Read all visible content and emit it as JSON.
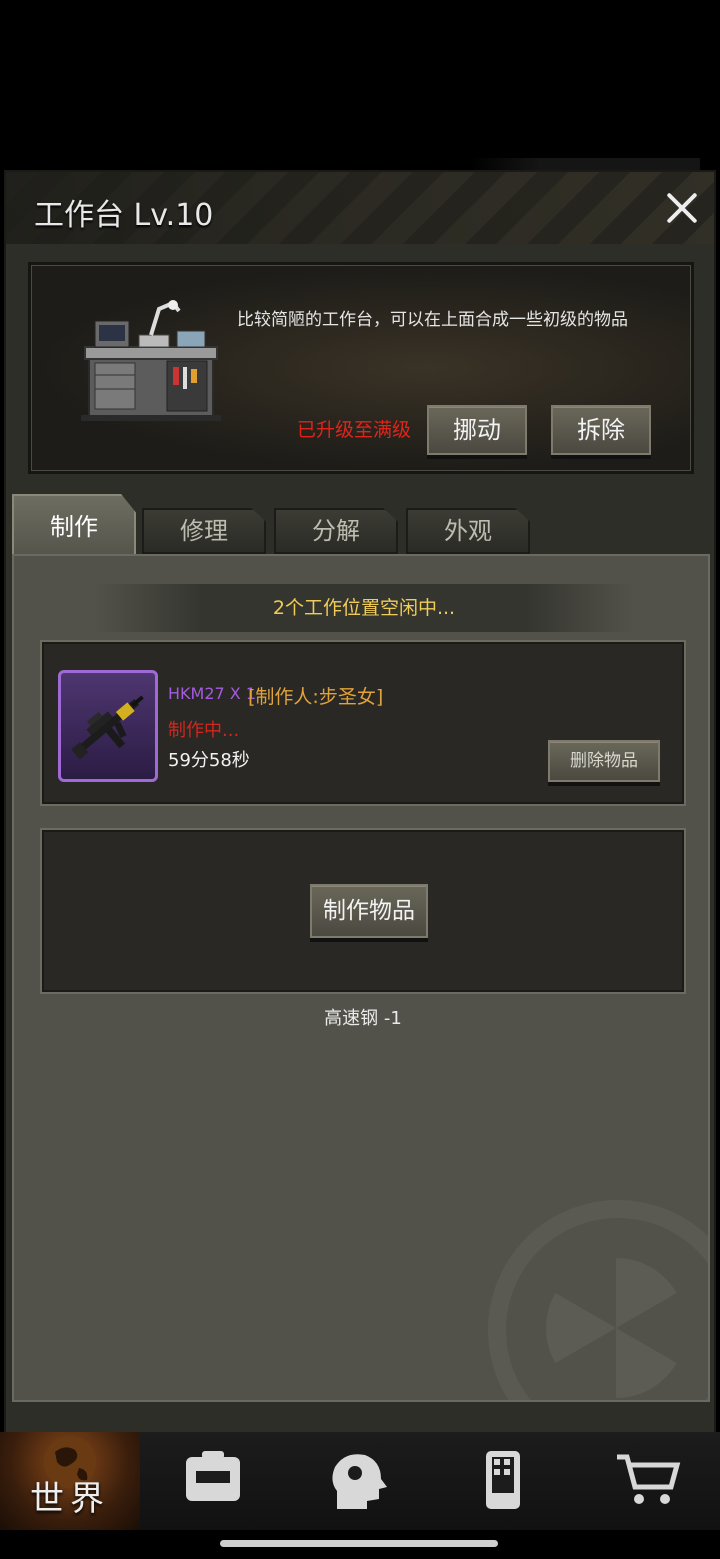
{
  "panel": {
    "title": "工作台 Lv.10",
    "close_icon": "close-icon"
  },
  "info": {
    "description": "比较简陋的工作台，可以在上面合成一些初级的物品",
    "max_level": "已升级至满级",
    "move_label": "挪动",
    "remove_label": "拆除"
  },
  "tabs": [
    {
      "label": "制作",
      "active": true
    },
    {
      "label": "修理",
      "active": false
    },
    {
      "label": "分解",
      "active": false
    },
    {
      "label": "外观",
      "active": false
    }
  ],
  "craft": {
    "slots_status": "2个工作位置空闲中...",
    "active_item": {
      "name": "HKM27 X 1",
      "maker": "[制作人:步圣女]",
      "status": "制作中...",
      "timer": "59分58秒",
      "delete_label": "删除物品",
      "icon": "rifle-icon"
    },
    "craft_button_label": "制作物品",
    "cost": "高速钢 -1"
  },
  "bottom_nav": {
    "world_label": "世界",
    "items": [
      "globe-icon",
      "backpack-icon",
      "head-skill-icon",
      "phone-icon",
      "cart-icon"
    ]
  },
  "colors": {
    "accent_gold": "#f0cc58",
    "status_red": "#d1271c",
    "rarity_purple": "#a55be0",
    "maker_orange": "#e2a23a"
  }
}
